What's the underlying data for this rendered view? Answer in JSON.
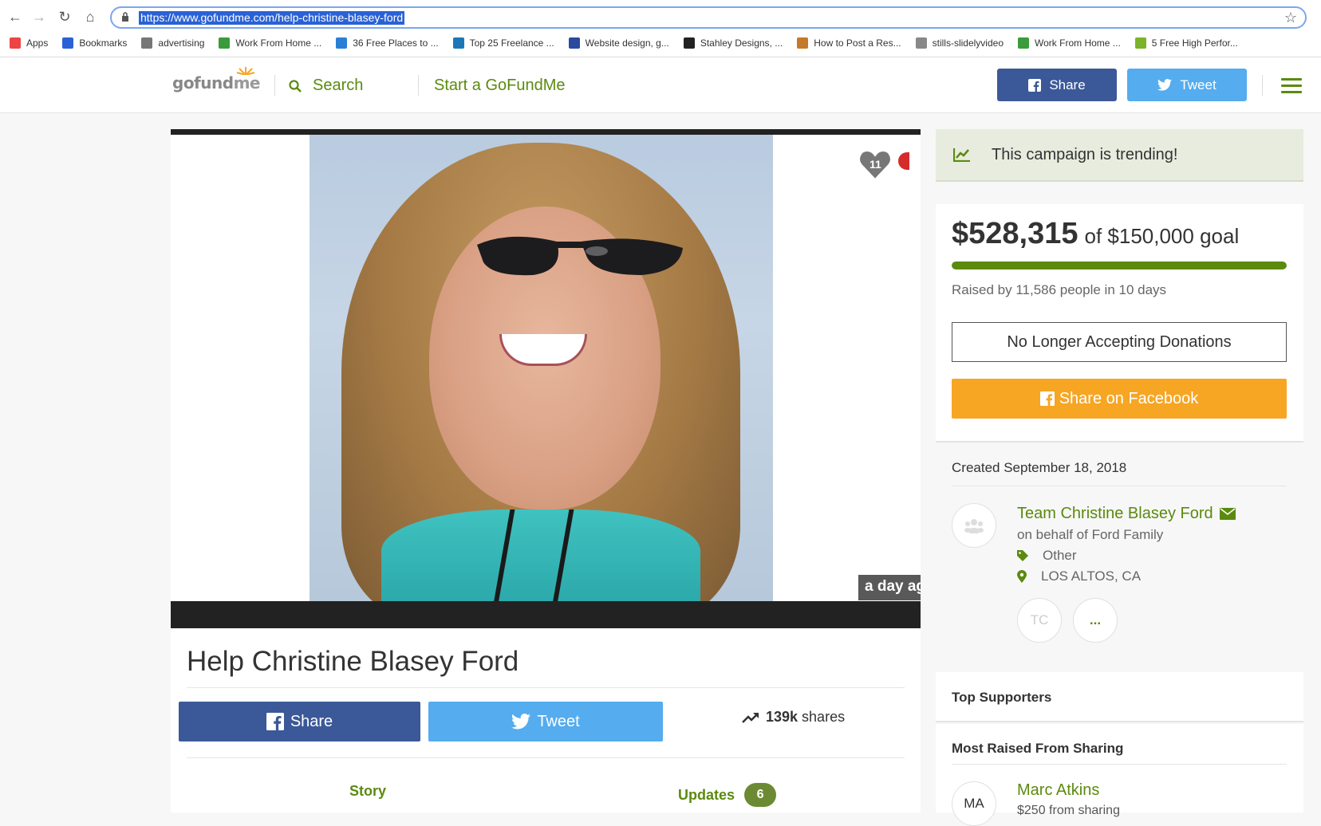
{
  "browser": {
    "url": "https://www.gofundme.com/help-christine-blasey-ford",
    "bookmarks": [
      {
        "label": "Apps",
        "color": "#e44"
      },
      {
        "label": "Bookmarks",
        "color": "#2a62d6"
      },
      {
        "label": "advertising",
        "color": "#777"
      },
      {
        "label": "Work From Home ...",
        "color": "#3a9b3a"
      },
      {
        "label": "36 Free Places to ...",
        "color": "#2a7fd6"
      },
      {
        "label": "Top 25 Freelance ...",
        "color": "#1a78b8"
      },
      {
        "label": "Website design, g...",
        "color": "#2a4aa0"
      },
      {
        "label": "Stahley Designs, ...",
        "color": "#222"
      },
      {
        "label": "How to Post a Res...",
        "color": "#c47a2a"
      },
      {
        "label": "stills-slidelyvideo",
        "color": "#888"
      },
      {
        "label": "Work From Home ...",
        "color": "#3a9b3a"
      },
      {
        "label": "5 Free High Perfor...",
        "color": "#7bb32a"
      }
    ]
  },
  "header": {
    "logo_text_a": "gofund",
    "logo_text_b": "me",
    "search_label": "Search",
    "start_label": "Start a GoFundMe",
    "share_label": "Share",
    "tweet_label": "Tweet"
  },
  "media": {
    "heart_count": "11",
    "time_badge": "a day ago"
  },
  "campaign": {
    "title": "Help Christine Blasey Ford",
    "share_label": "Share",
    "tweet_label": "Tweet",
    "shares_count": "139k",
    "shares_word": "shares",
    "tab_story": "Story",
    "tab_updates": "Updates",
    "updates_count": "6"
  },
  "sidebar": {
    "trending_text": "This campaign is trending!",
    "raised_amount": "$528,315",
    "goal_text": "of $150,000 goal",
    "progress_fraction": 1.0,
    "raised_by": "Raised by 11,586 people in 10 days",
    "no_longer_label": "No Longer Accepting Donations",
    "share_fb_label": "Share on Facebook",
    "created": "Created September 18, 2018",
    "organizer": "Team Christine Blasey Ford",
    "behalf": "on behalf of Ford Family",
    "category": "Other",
    "location": "LOS ALTOS, CA",
    "team_initials": "TC",
    "more_label": "...",
    "top_supporters": "Top Supporters",
    "most_raised": "Most Raised From Sharing",
    "supporter_initials": "MA",
    "supporter_name": "Marc Atkins",
    "supporter_amount": "$250 from sharing"
  },
  "colors": {
    "brand_green": "#5b8a0f",
    "facebook": "#3b5998",
    "twitter": "#55acee",
    "share_orange": "#f6a623"
  }
}
